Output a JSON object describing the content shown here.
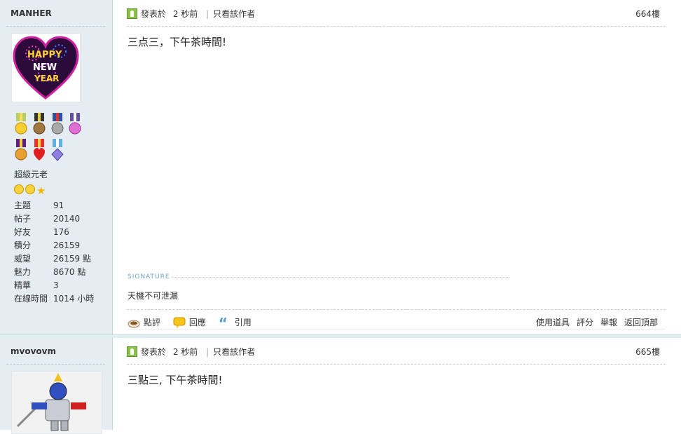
{
  "post1": {
    "author": "MANHER",
    "avatar_text": "Happy new year",
    "rank": "超級元老",
    "stats": [
      {
        "key": "主題",
        "value": "91"
      },
      {
        "key": "帖子",
        "value": "20140"
      },
      {
        "key": "好友",
        "value": "176"
      },
      {
        "key": "積分",
        "value": "26159"
      },
      {
        "key": "威望",
        "value": "26159 點"
      },
      {
        "key": "魅力",
        "value": "8670 點"
      },
      {
        "key": "精華",
        "value": "3"
      },
      {
        "key": "在線時間",
        "value": "1014 小時"
      }
    ],
    "posted_label": "發表於",
    "posted_time": "2 秒前",
    "only_author": "只看該作者",
    "floor": "664樓",
    "message": "三点三，下午茶時間!",
    "signature_label": "SIGNATURE",
    "signature": "天機不可泄漏",
    "actions_left": [
      "點評",
      "回應",
      "引用"
    ],
    "actions_right": [
      "使用道具",
      "評分",
      "舉報",
      "返回頂部"
    ]
  },
  "post2": {
    "author": "mvovovm",
    "posted_label": "發表於",
    "posted_time": "2 秒前",
    "only_author": "只看該作者",
    "floor": "665樓",
    "message": "三點三, 下午茶時間!"
  },
  "colors": {
    "sidebar_bg": "#e5edf2",
    "sidebar_border": "#c2d5e3",
    "signature_label": "#6fa6c7",
    "online_icon": "#8bc34a"
  }
}
